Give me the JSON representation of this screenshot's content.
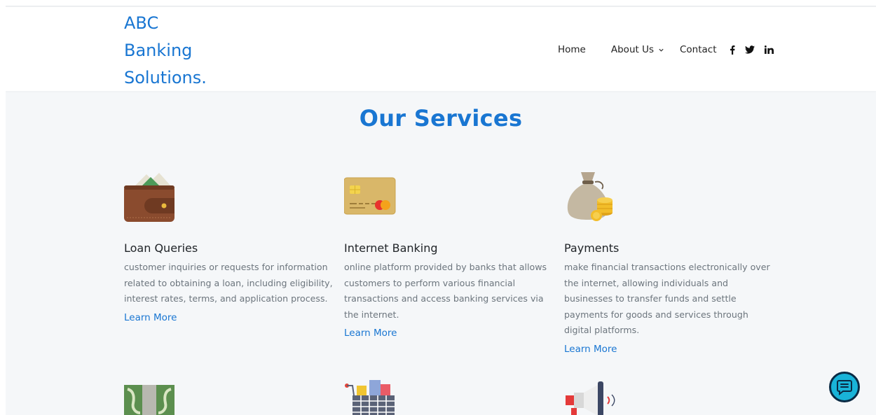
{
  "brand": {
    "lines": [
      "ABC",
      "Banking",
      "Solutions."
    ],
    "color": "#1976d2"
  },
  "nav": {
    "items": [
      {
        "label": "Home"
      },
      {
        "label": "About Us",
        "has_dropdown": true
      },
      {
        "label": "Contact"
      }
    ],
    "social": [
      "facebook-icon",
      "twitter-icon",
      "linkedin-icon"
    ]
  },
  "services": {
    "title": "Our Services",
    "items": [
      {
        "title": "Loan Queries",
        "description": "customer inquiries or requests for information related to obtaining a loan, including eligibility, interest rates, terms, and application process.",
        "link": "Learn More",
        "icon": "wallet-icon"
      },
      {
        "title": "Internet Banking",
        "description": "online platform provided by banks that allows customers to perform various financial transactions and access banking services via the internet.",
        "link": "Learn More",
        "icon": "credit-card-icon"
      },
      {
        "title": "Payments",
        "description": "make financial transactions electronically over the internet, allowing individuals and businesses to transfer funds and settle payments for goods and services through digital platforms.",
        "link": "Learn More",
        "icon": "money-bag-icon"
      }
    ],
    "next_row_icons": [
      "banknote-icon",
      "shopping-cart-icon",
      "megaphone-icon"
    ]
  },
  "chat": {
    "icon": "chat-icon"
  },
  "colors": {
    "accent": "#1976d2",
    "section_bg": "#f5f7f9",
    "text_muted": "#6c757d",
    "chat_bg": "#19b3d8"
  }
}
